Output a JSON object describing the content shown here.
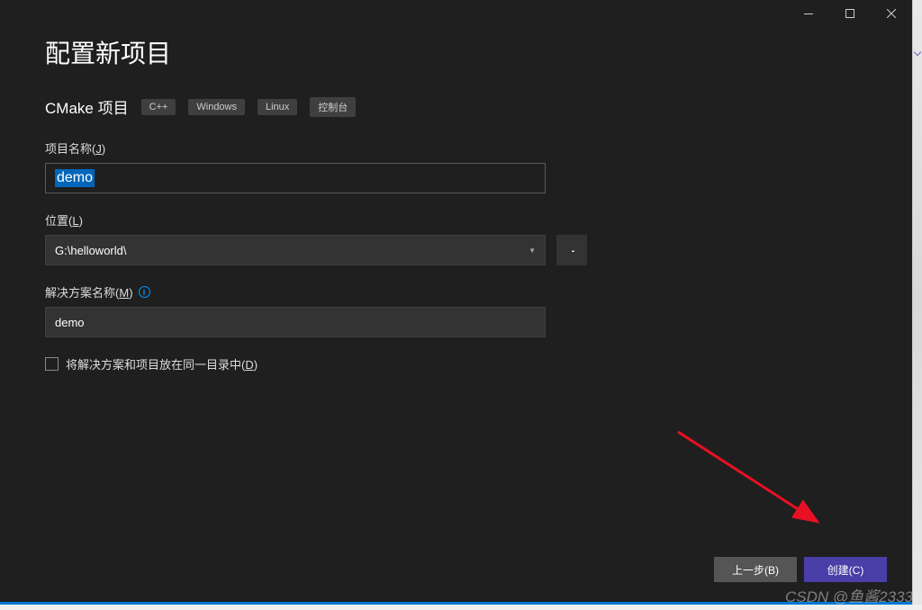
{
  "page_title": "配置新项目",
  "project_type": "CMake 项目",
  "tags": [
    "C++",
    "Windows",
    "Linux",
    "控制台"
  ],
  "fields": {
    "project_name": {
      "label_prefix": "项目名称(",
      "label_accel": "J",
      "label_suffix": ")",
      "value": "demo"
    },
    "location": {
      "label_prefix": "位置(",
      "label_accel": "L",
      "label_suffix": ")",
      "value": "G:\\helloworld\\"
    },
    "solution_name": {
      "label_prefix": "解决方案名称(",
      "label_accel": "M",
      "label_suffix": ")",
      "value": "demo"
    },
    "same_dir": {
      "label_prefix": "将解决方案和项目放在同一目录中(",
      "label_accel": "D",
      "label_suffix": ")",
      "checked": false
    }
  },
  "buttons": {
    "back": "上一步(B)",
    "create": "创建(C)"
  },
  "browse": "...",
  "watermark": "CSDN @鱼酱2333"
}
